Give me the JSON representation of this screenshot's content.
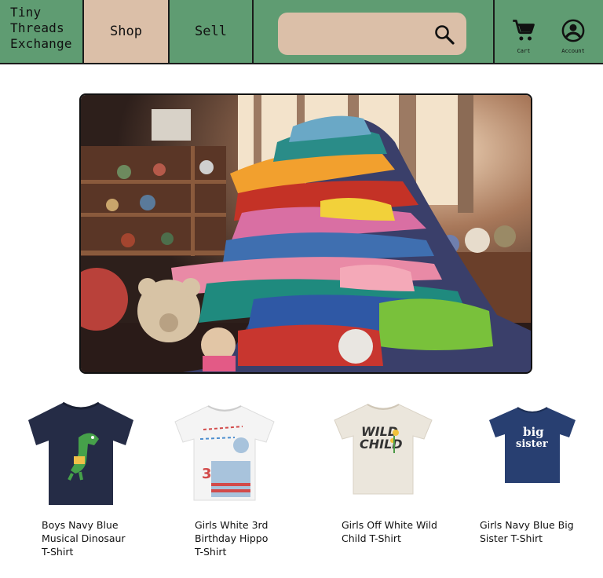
{
  "brand": {
    "line1": "Tiny",
    "line2": "Threads",
    "line3": "Exchange"
  },
  "nav": {
    "shop_label": "Shop",
    "sell_label": "Sell",
    "active_tab": "Shop"
  },
  "search": {
    "value": "",
    "placeholder": ""
  },
  "header_actions": {
    "cart_label": "Cart",
    "account_label": "Account"
  },
  "colors": {
    "navbar": "#5f9c72",
    "accent": "#dbbfa8",
    "border": "#1b1b1b"
  },
  "hero": {
    "alt": "pile of clothes"
  },
  "products": [
    {
      "title": "Boys Navy Blue\nMusical Dinosaur\nT-Shirt"
    },
    {
      "title": "Girls White 3rd\nBirthday Hippo\nT-Shirt"
    },
    {
      "title": "Girls Off White Wild\nChild T-Shirt"
    },
    {
      "title": "Girls Navy Blue Big\nSister T-Shirt"
    }
  ],
  "shirt_prints": {
    "wild_line1": "WILD",
    "wild_line2": "CHILD",
    "big": "big",
    "sister": "sister",
    "birthday_num": "3"
  }
}
